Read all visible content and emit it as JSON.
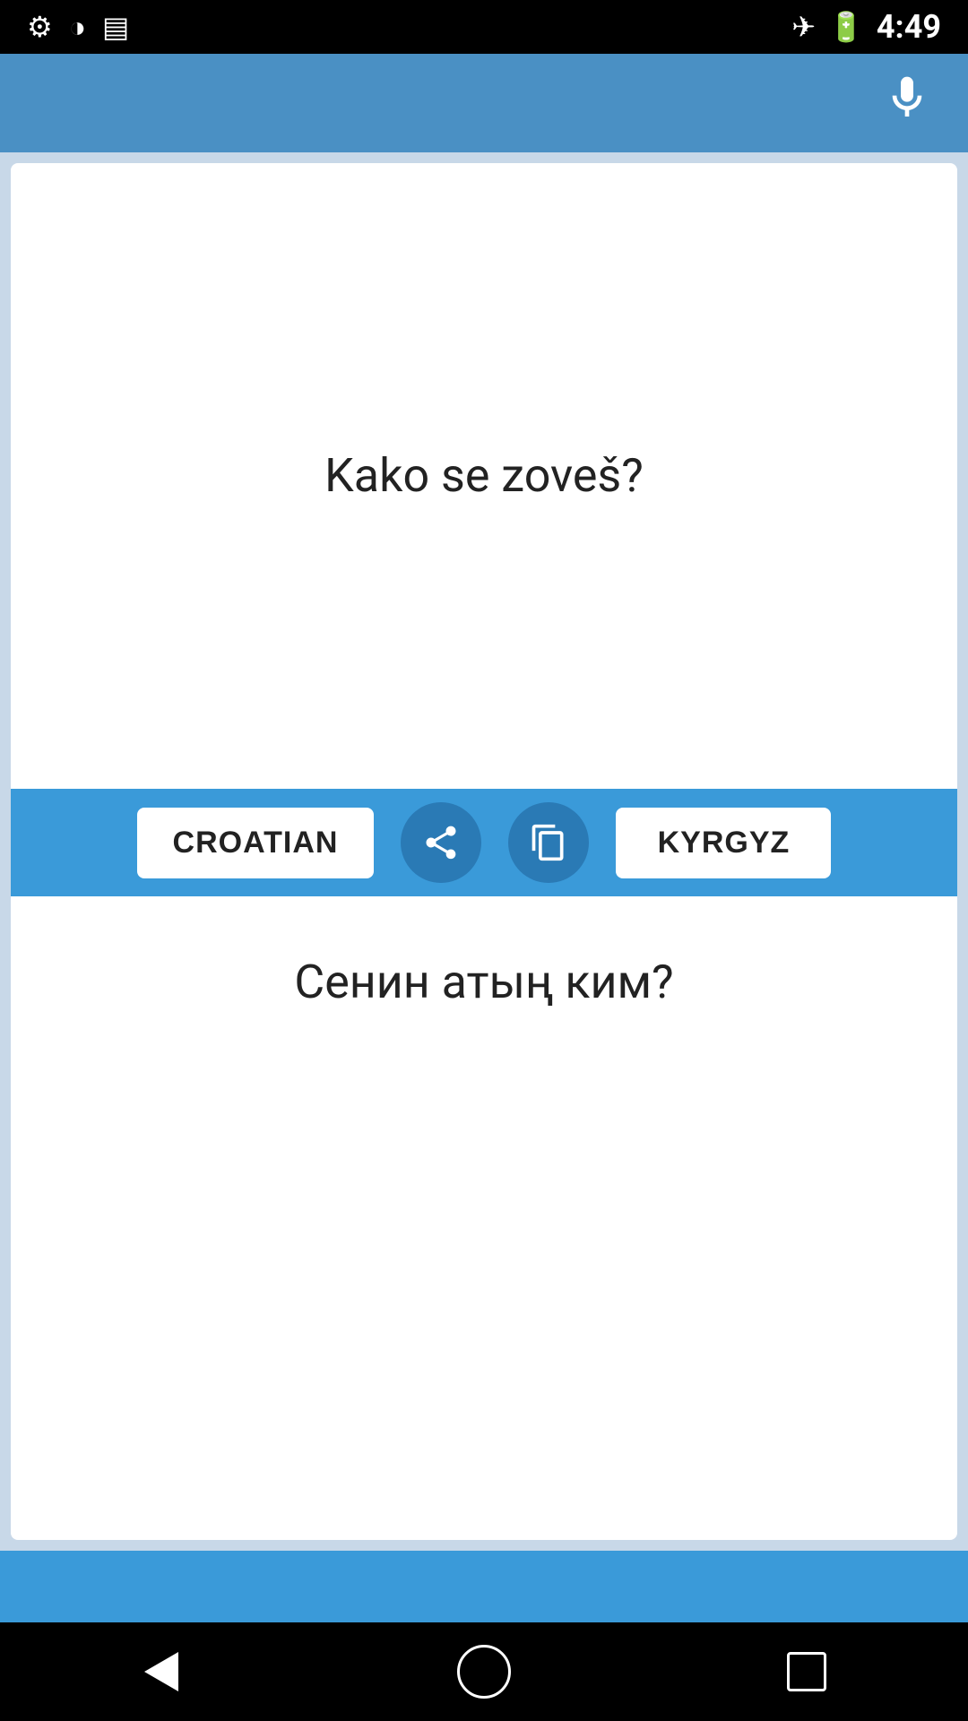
{
  "statusBar": {
    "time": "4:49",
    "icons": [
      "settings",
      "circle-half",
      "sd-card",
      "airplane",
      "battery"
    ]
  },
  "toolbar": {
    "micLabel": "microphone"
  },
  "sourceLanguage": {
    "label": "CROATIAN",
    "text": "Kako se zoveš?"
  },
  "targetLanguage": {
    "label": "KYRGYZ",
    "text": "Сенин атың ким?"
  },
  "actions": {
    "share": "share",
    "copy": "copy"
  },
  "navBar": {
    "back": "back",
    "home": "home",
    "recent": "recent apps"
  }
}
